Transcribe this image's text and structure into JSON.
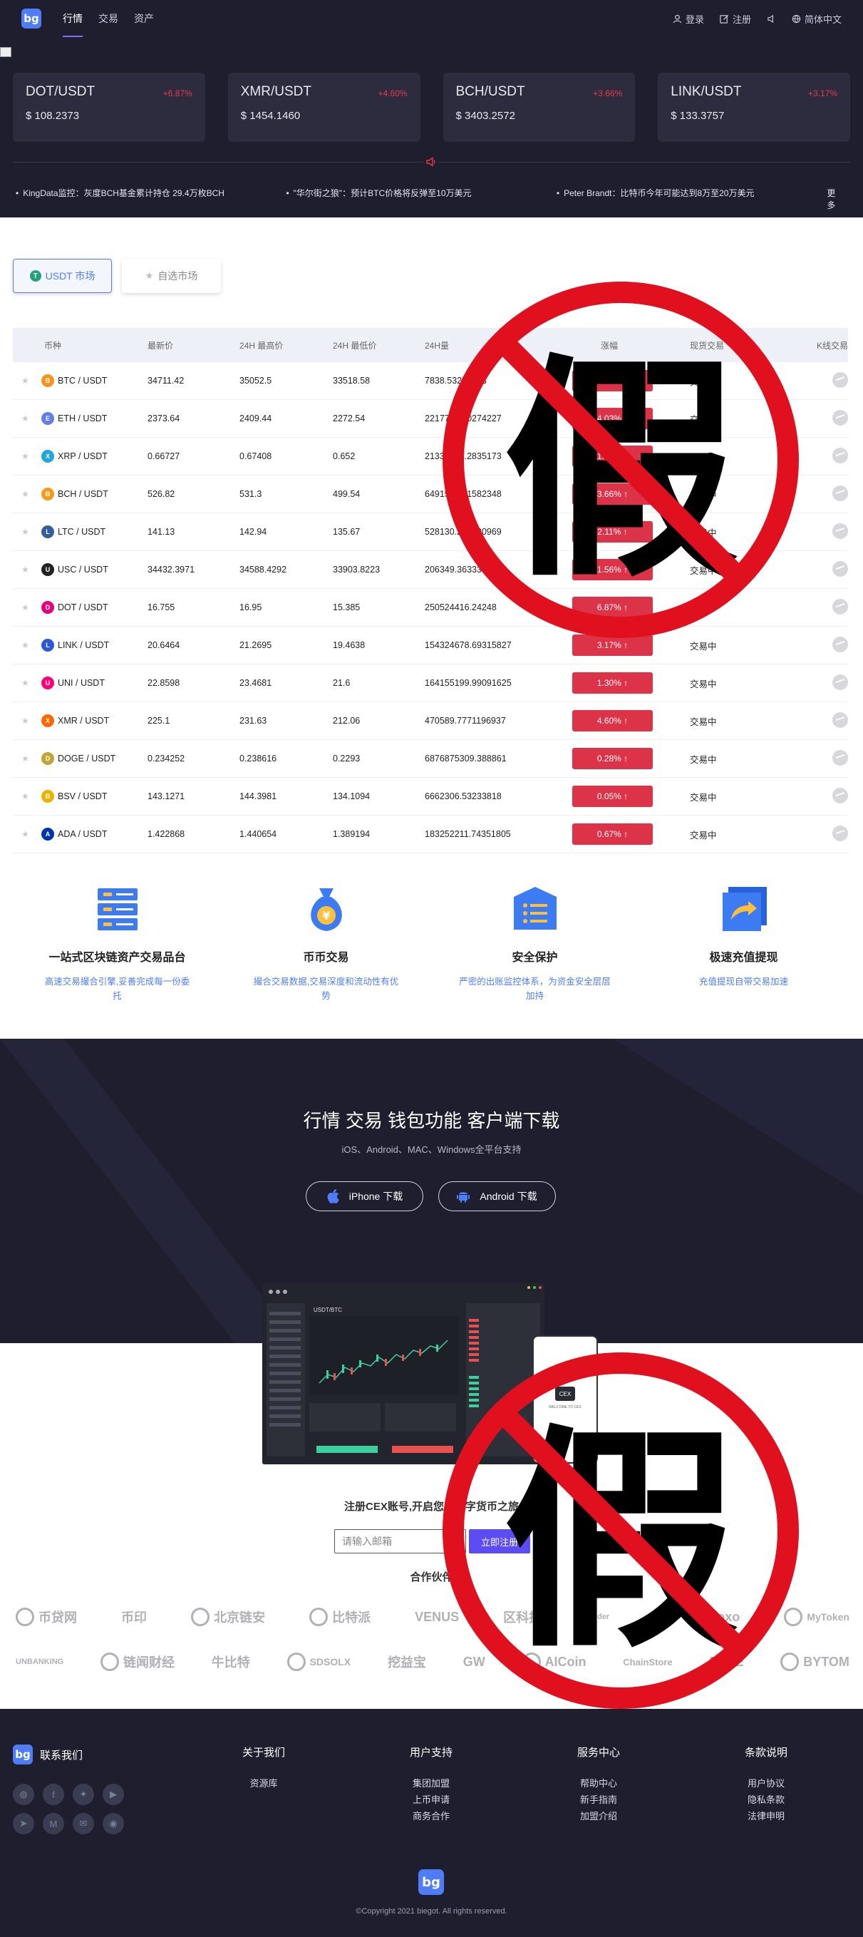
{
  "nav": {
    "logo": "bg",
    "links": [
      "行情",
      "交易",
      "资产"
    ],
    "login": "登录",
    "register": "注册",
    "language": "简体中文"
  },
  "tickers": [
    {
      "pair": "DOT/USDT",
      "change": "+6.87%",
      "price": "$ 108.2373"
    },
    {
      "pair": "XMR/USDT",
      "change": "+4.60%",
      "price": "$ 1454.1460"
    },
    {
      "pair": "BCH/USDT",
      "change": "+3.66%",
      "price": "$ 3403.2572"
    },
    {
      "pair": "LINK/USDT",
      "change": "+3.17%",
      "price": "$ 133.3757"
    }
  ],
  "news": [
    "KingData监控：灰度BCH基金累计持仓 29.4万枚BCH",
    "\"华尔街之狼\"：预计BTC价格将反弹至10万美元",
    "Peter Brandt：比特币今年可能达到8万至20万美元"
  ],
  "news_more": "更多",
  "market_tabs": {
    "usdt": "USDT 市场",
    "favorites": "自选市场"
  },
  "table": {
    "headers": [
      "币种",
      "最新价",
      "24H 最高价",
      "24H 最低价",
      "24H量",
      "涨幅",
      "现货交易",
      "K线交易"
    ],
    "rows": [
      {
        "coin": "BTC",
        "pair": "BTC / USDT",
        "last": "34711.42",
        "high": "35052.5",
        "low": "33518.58",
        "vol": "7838.53272223",
        "chg": "4.53% ↑",
        "status": "交易中",
        "color": "#f7931a"
      },
      {
        "coin": "ETH",
        "pair": "ETH / USDT",
        "last": "2373.64",
        "high": "2409.44",
        "low": "2272.54",
        "vol": "2217707.00274227",
        "chg": "4.03% ↑",
        "status": "交易中",
        "color": "#627eea"
      },
      {
        "coin": "XRP",
        "pair": "XRP / USDT",
        "last": "0.66727",
        "high": "0.67408",
        "low": "0.652",
        "vol": "21337186.2835173",
        "chg": "1.73% ↑",
        "status": "交易中",
        "color": "#23a3e0"
      },
      {
        "coin": "BCH",
        "pair": "BCH / USDT",
        "last": "526.82",
        "high": "531.3",
        "low": "499.54",
        "vol": "64915.1341582348",
        "chg": "3.66% ↑",
        "status": "交易中",
        "color": "#f29c1f"
      },
      {
        "coin": "LTC",
        "pair": "LTC / USDT",
        "last": "141.13",
        "high": "142.94",
        "low": "135.67",
        "vol": "528130.210690969",
        "chg": "2.11% ↑",
        "status": "交易中",
        "color": "#345d9d"
      },
      {
        "coin": "USC",
        "pair": "USC / USDT",
        "last": "34432.3971",
        "high": "34588.4292",
        "low": "33903.8223",
        "vol": "206349.363333338",
        "chg": "1.56% ↑",
        "status": "交易中",
        "color": "#222222"
      },
      {
        "coin": "DOT",
        "pair": "DOT / USDT",
        "last": "16.755",
        "high": "16.95",
        "low": "15.385",
        "vol": "250524416.24248",
        "chg": "6.87% ↑",
        "status": "交易中",
        "color": "#e6007a"
      },
      {
        "coin": "LINK",
        "pair": "LINK / USDT",
        "last": "20.6464",
        "high": "21.2695",
        "low": "19.4638",
        "vol": "154324678.69315827",
        "chg": "3.17% ↑",
        "status": "交易中",
        "color": "#2a5ada"
      },
      {
        "coin": "UNI",
        "pair": "UNI / USDT",
        "last": "22.8598",
        "high": "23.4681",
        "low": "21.6",
        "vol": "164155199.99091625",
        "chg": "1.30% ↑",
        "status": "交易中",
        "color": "#ff007a"
      },
      {
        "coin": "XMR",
        "pair": "XMR / USDT",
        "last": "225.1",
        "high": "231.63",
        "low": "212.06",
        "vol": "470589.7771196937",
        "chg": "4.60% ↑",
        "status": "交易中",
        "color": "#ff6600"
      },
      {
        "coin": "DOGE",
        "pair": "DOGE / USDT",
        "last": "0.234252",
        "high": "0.238616",
        "low": "0.2293",
        "vol": "6876875309.388861",
        "chg": "0.28% ↑",
        "status": "交易中",
        "color": "#c2a633"
      },
      {
        "coin": "BSV",
        "pair": "BSV / USDT",
        "last": "143.1271",
        "high": "144.3981",
        "low": "134.1094",
        "vol": "6662306.53233818",
        "chg": "0.05% ↑",
        "status": "交易中",
        "color": "#eab300"
      },
      {
        "coin": "ADA",
        "pair": "ADA / USDT",
        "last": "1.422868",
        "high": "1.440654",
        "low": "1.389194",
        "vol": "183252211.74351805",
        "chg": "0.67% ↑",
        "status": "交易中",
        "color": "#0033ad"
      }
    ]
  },
  "features": [
    {
      "title": "一站式区块链资产交易品台",
      "desc": "高速交易撮合引擎,妥善完成每一份委托"
    },
    {
      "title": "币币交易",
      "desc": "撮合交易数据,交易深度和流动性有优势"
    },
    {
      "title": "安全保护",
      "desc": "严密的出账监控体系，为资金安全层层加持"
    },
    {
      "title": "极速充值提现",
      "desc": "充值提现自带交易加速"
    }
  ],
  "download": {
    "title": "行情 交易 钱包功能 客户端下载",
    "subtitle": "iOS、Android、MAC、Windows全平台支持",
    "iphone": "iPhone 下载",
    "android": "Android 下载",
    "mockup_pair": "USDT/BTC",
    "phone_brand": "CEX",
    "phone_welcome": "WELCOME TO CEX"
  },
  "register": {
    "title": "注册CEX账号,开启您的数字货币之旅",
    "placeholder": "请输入邮箱",
    "button": "立即注册"
  },
  "partners_title": "合作伙伴",
  "partners_row1": [
    "币贷网",
    "币印",
    "北京链安",
    "比特派",
    "VENUS",
    "区科技",
    "spider",
    "d",
    "moxo",
    "MyToken"
  ],
  "partners_row2": [
    "UNBANKING",
    "链闻财经",
    "牛比特",
    "SDSOLX",
    "挖益宝",
    "GW",
    "AICoin",
    "ChainStore",
    "FREE",
    "BYTOM"
  ],
  "footer": {
    "contact": "联系我们",
    "cols": [
      {
        "title": "关于我们",
        "links": [
          "资源库"
        ]
      },
      {
        "title": "用户支持",
        "links": [
          "集团加盟",
          "上币申请",
          "商务合作"
        ]
      },
      {
        "title": "服务中心",
        "links": [
          "帮助中心",
          "新手指南",
          "加盟介绍"
        ]
      },
      {
        "title": "条款说明",
        "links": [
          "用户协议",
          "隐私条款",
          "法律申明"
        ]
      }
    ],
    "copyright": "©Copyright 2021 biegot. All rights reserved."
  },
  "stamp_text": "假",
  "colors": {
    "accent": "#4f7df7",
    "up": "#dd3348",
    "dark_bg": "#1e1e2e",
    "stamp": "#e0101e"
  }
}
